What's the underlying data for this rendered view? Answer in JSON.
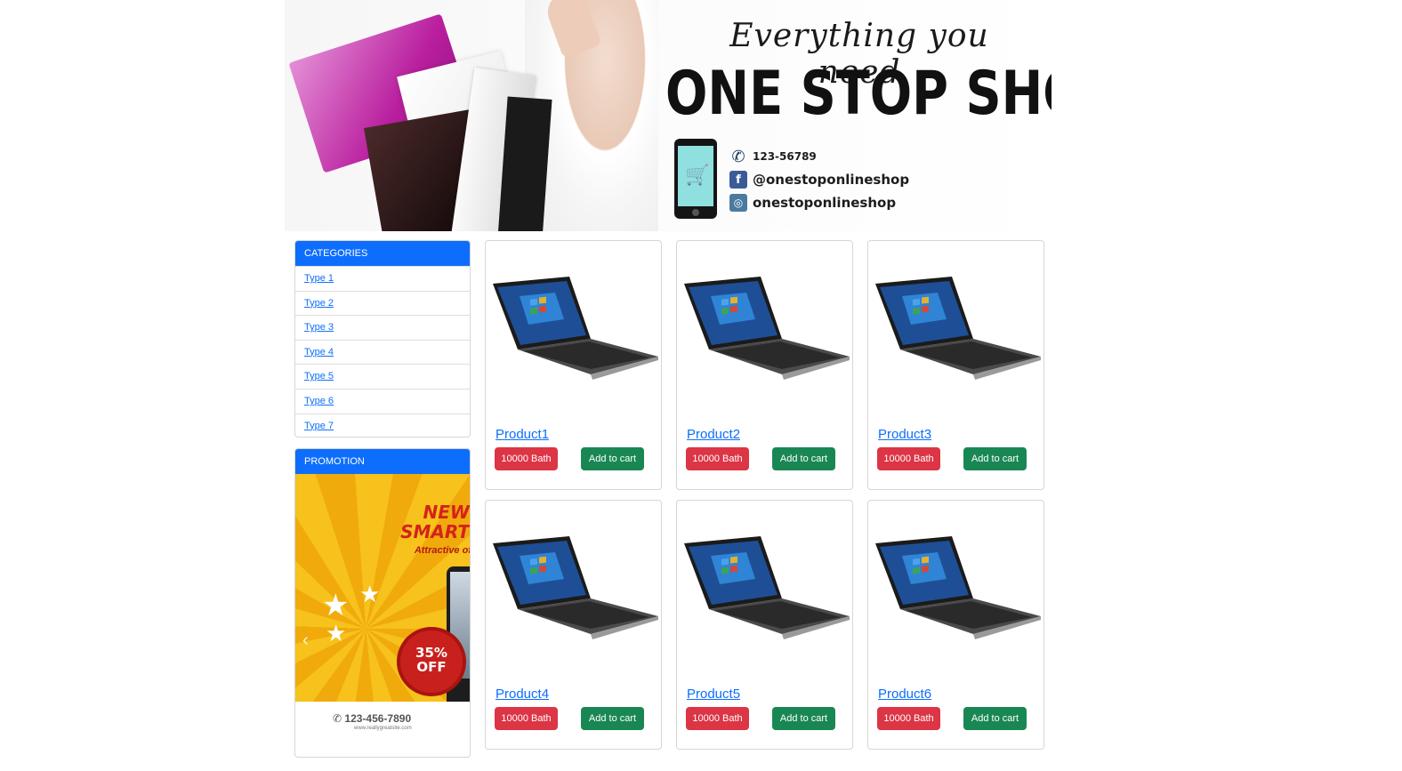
{
  "banner": {
    "tagline": "Everything you need",
    "title": "ONE STOP SHOP",
    "contacts": [
      {
        "icon": "phone-icon",
        "text": "123-56789"
      },
      {
        "icon": "facebook-icon",
        "text": "@onestoponlineshop"
      },
      {
        "icon": "instagram-icon",
        "text": "onestoponlineshop"
      }
    ]
  },
  "sidebar": {
    "categories": {
      "header": "CATEGORIES",
      "items": [
        {
          "label": "Type 1"
        },
        {
          "label": "Type 2"
        },
        {
          "label": "Type 3"
        },
        {
          "label": "Type 4"
        },
        {
          "label": "Type 5"
        },
        {
          "label": "Type 6"
        },
        {
          "label": "Type 7"
        }
      ]
    },
    "promotion": {
      "header": "PROMOTION",
      "headline_1": "NEW",
      "headline_2": "SMART",
      "subline": "Attractive of",
      "badge_percent": "35%",
      "badge_off": "OFF",
      "phone": "123-456-7890",
      "site": "www.reallygreatsite.com",
      "prev_icon": "chevron-left-icon"
    }
  },
  "products": [
    {
      "name": "Product1",
      "price": "10000 Bath",
      "cart_label": "Add to cart"
    },
    {
      "name": "Product2",
      "price": "10000 Bath",
      "cart_label": "Add to cart"
    },
    {
      "name": "Product3",
      "price": "10000 Bath",
      "cart_label": "Add to cart"
    },
    {
      "name": "Product4",
      "price": "10000 Bath",
      "cart_label": "Add to cart"
    },
    {
      "name": "Product5",
      "price": "10000 Bath",
      "cart_label": "Add to cart"
    },
    {
      "name": "Product6",
      "price": "10000 Bath",
      "cart_label": "Add to cart"
    }
  ],
  "colors": {
    "primary": "#0d6efd",
    "danger": "#dc3545",
    "success": "#198754"
  }
}
